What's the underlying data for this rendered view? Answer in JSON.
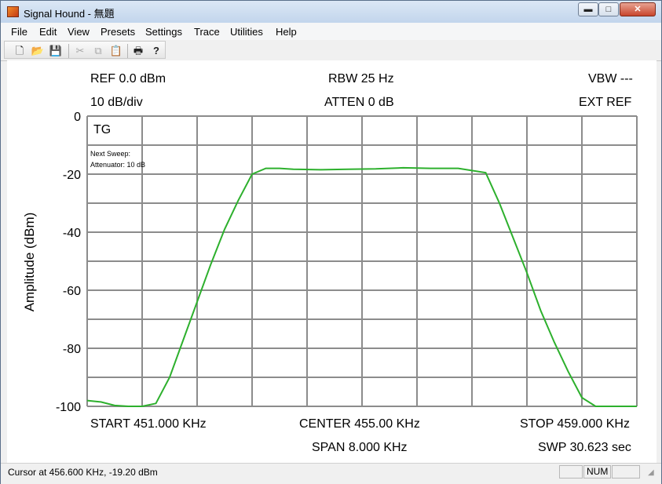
{
  "window": {
    "title": "Signal Hound - 無題",
    "minimize_glyph": "▬",
    "maximize_glyph": "□",
    "close_glyph": "✕"
  },
  "menu": [
    "File",
    "Edit",
    "View",
    "Presets",
    "Settings",
    "Trace",
    "Utilities",
    "Help"
  ],
  "toolbar": {
    "icons": [
      "new-file-icon",
      "open-folder-icon",
      "save-icon",
      "cut-icon",
      "copy-icon",
      "paste-icon",
      "print-icon",
      "help-icon"
    ],
    "glyphs": [
      "🗋",
      "📂",
      "💾",
      "✂",
      "⧉",
      "📋",
      "🖶",
      "?"
    ]
  },
  "analyzer": {
    "ref": "REF 0.0 dBm",
    "scale": "10 dB/div",
    "rbw": "RBW 25 Hz",
    "atten": "ATTEN 0 dB",
    "vbw": "VBW ---",
    "ext_ref": "EXT REF",
    "tg": "TG",
    "next_sweep_line1": "Next Sweep:",
    "next_sweep_line2": "Attenuator: 10 dB",
    "start": "START 451.000 KHz",
    "center": "CENTER 455.00 KHz",
    "stop": "STOP 459.000 KHz",
    "span": "SPAN 8.000 KHz",
    "swp": "SWP 30.623 sec"
  },
  "status": {
    "cursor": "Cursor at 456.600 KHz, -19.20 dBm",
    "num": "NUM"
  },
  "chart_data": {
    "type": "line",
    "ylabel": "Amplitude (dBm)",
    "xlabel": "",
    "xlim": [
      451.0,
      459.0
    ],
    "ylim": [
      -100,
      0
    ],
    "yticks": [
      "0",
      "-20",
      "-40",
      "-60",
      "-80",
      "-100"
    ],
    "grid": true,
    "trace_color": "#2db02d",
    "series": [
      {
        "x": [
          451.0,
          451.2,
          451.4,
          451.6,
          451.8,
          452.0,
          452.2,
          452.4,
          452.6,
          452.8,
          453.0,
          453.2,
          453.4,
          453.6,
          453.8,
          454.0,
          454.4,
          454.8,
          455.2,
          455.6,
          456.0,
          456.4,
          456.8,
          457.0,
          457.2,
          457.4,
          457.6,
          457.8,
          458.0,
          458.2,
          458.4,
          458.6,
          458.8,
          459.0
        ],
        "y": [
          -98,
          -98.5,
          -99.7,
          -100,
          -100,
          -99,
          -90,
          -77,
          -64,
          -51,
          -39,
          -29,
          -20,
          -18,
          -18,
          -18.3,
          -18.5,
          -18.3,
          -18.2,
          -17.8,
          -18,
          -18,
          -19.5,
          -30,
          -42,
          -54,
          -67,
          -78,
          -88,
          -97,
          -100,
          -100,
          -100,
          -100
        ]
      }
    ]
  }
}
